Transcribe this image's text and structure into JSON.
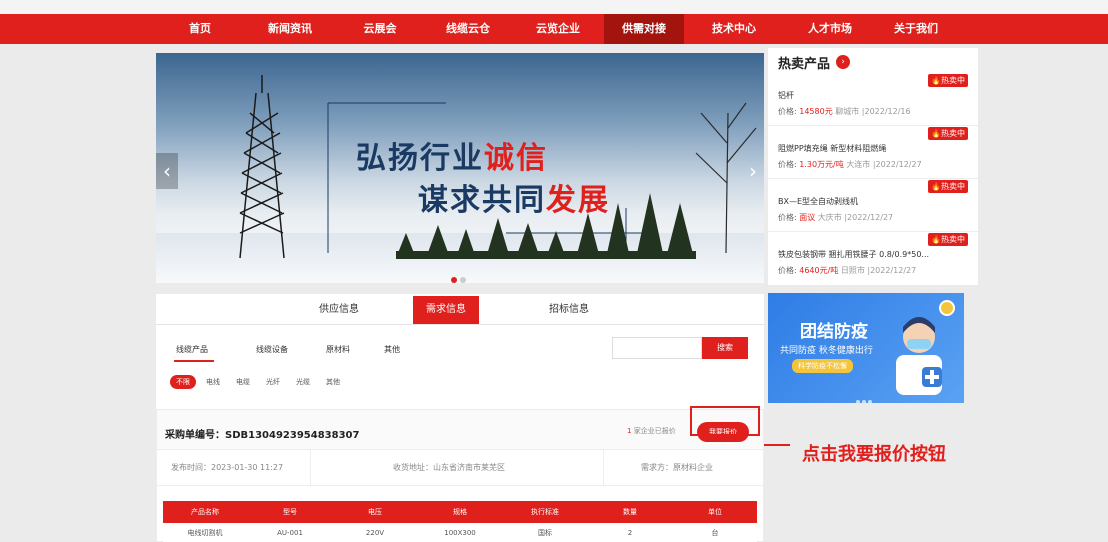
{
  "nav": {
    "items": [
      "首页",
      "新闻资讯",
      "云展会",
      "线缆云仓",
      "云览企业",
      "供需对接",
      "技术中心",
      "人才市场",
      "关于我们"
    ],
    "active_index": 5
  },
  "banner": {
    "line1_a": "弘扬行业",
    "line1_b": "诚信",
    "line2_a": "谋求共同",
    "line2_b": "发展",
    "prev": "‹",
    "next": "›"
  },
  "hot": {
    "title": "热卖产品",
    "more": "›",
    "items": [
      {
        "badge": "🔥热卖中",
        "name": "铝杆",
        "price_label": "价格:",
        "price": "14580元",
        "place_date": "聊城市 |2022/12/16"
      },
      {
        "badge": "🔥热卖中",
        "name": "阻燃PP填充绳 新型材料阻燃绳",
        "price_label": "价格:",
        "price": "1.30万元/吨",
        "place_date": "大连市 |2022/12/27"
      },
      {
        "badge": "🔥热卖中",
        "name": "BX—E型全自动剥线机",
        "price_label": "价格:",
        "price": "面议",
        "place_date": "大庆市 |2022/12/27"
      },
      {
        "badge": "🔥热卖中",
        "name": "铁皮包装钢带 捆扎用铁腰子 0.8/0.9*50...",
        "price_label": "价格:",
        "price": "4640元/吨",
        "place_date": "日照市 |2022/12/27"
      }
    ]
  },
  "ad": {
    "title": "团结防疫",
    "subtitle": "共同防疫 秋冬健康出行",
    "tag": "科学防疫不松懈"
  },
  "tabs": [
    "供应信息",
    "需求信息",
    "招标信息"
  ],
  "tab_active": 1,
  "categories": [
    "线缆产品",
    "线缆设备",
    "原材料",
    "其他"
  ],
  "search": {
    "button": "搜索",
    "placeholder": ""
  },
  "subcats": [
    "不限",
    "电线",
    "电缆",
    "光纤",
    "光缆",
    "其他"
  ],
  "order": {
    "number": "采购单编号：SDB1304923954838307",
    "quoted_count": "1",
    "quoted_text": " 家企业已报价",
    "quote_button": "我要报价",
    "publish_time": "发布时间：2023-01-30 11:27",
    "address": "收货地址：山东省济南市莱芜区",
    "buyer": "需求方：原材料企业",
    "columns": [
      "产品名称",
      "型号",
      "电压",
      "规格",
      "执行标准",
      "数量",
      "单位"
    ],
    "row": [
      "电线切割机",
      "AU-001",
      "220V",
      "100X300",
      "国标",
      "2",
      "台"
    ]
  },
  "annotation": "点击我要报价按钮"
}
